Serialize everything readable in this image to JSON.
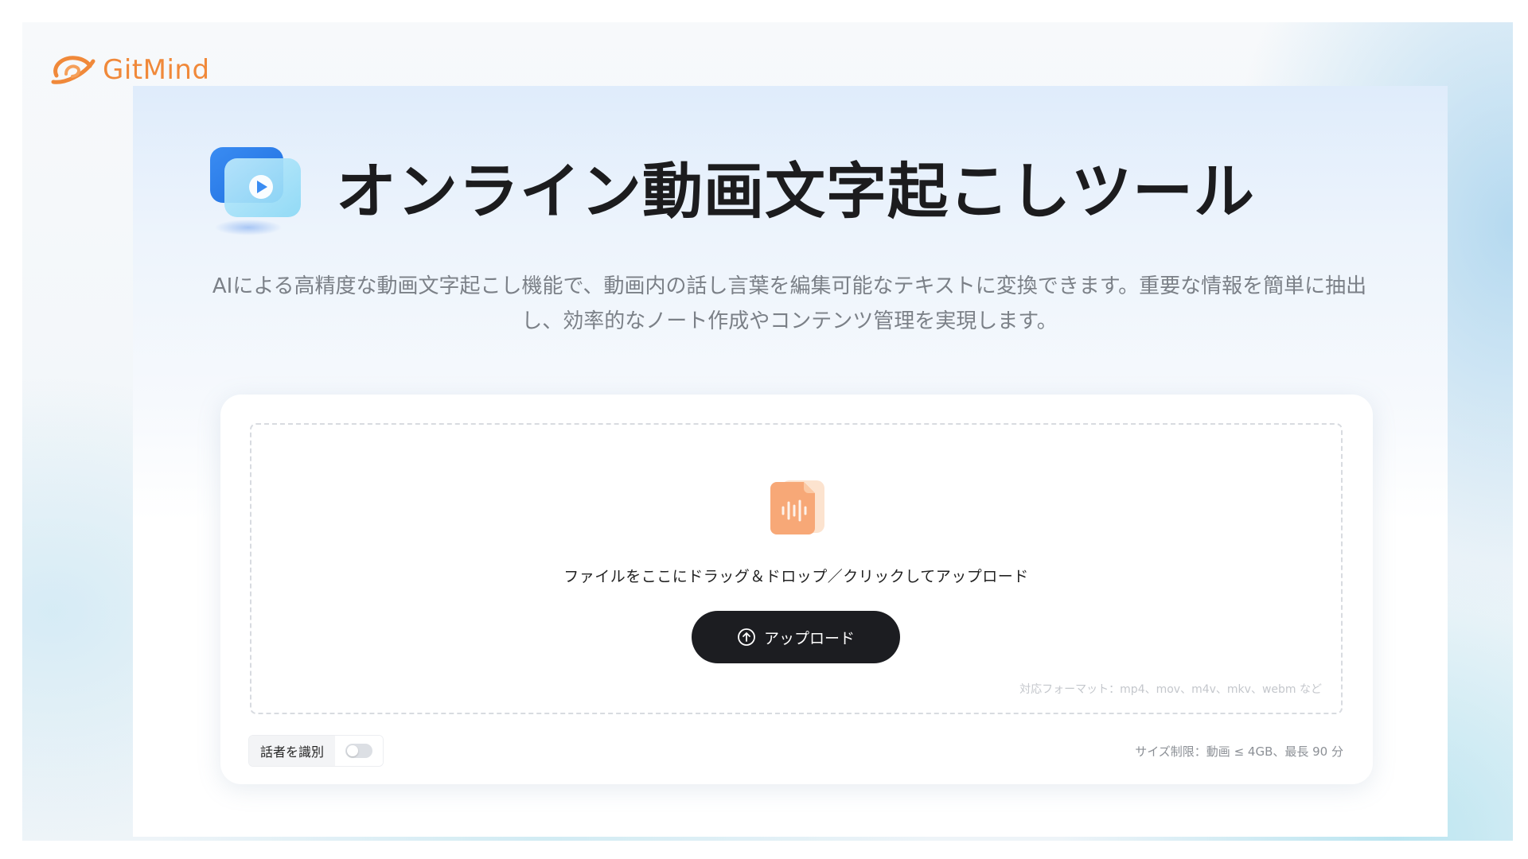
{
  "brand": {
    "name": "GitMind",
    "color": "#f0893a"
  },
  "hero": {
    "icon": "video-play-icon",
    "title": "オンライン動画文字起こしツール",
    "description": "AIによる高精度な動画文字起こし機能で、動画内の話し言葉を編集可能なテキストに変換できます。重要な情報を簡単に抽出し、効率的なノート作成やコンテンツ管理を実現します。"
  },
  "upload": {
    "file_icon": "audio-file-icon",
    "drop_text": "ファイルをここにドラッグ＆ドロップ／クリックしてアップロード",
    "button_label": "アップロード",
    "button_icon": "upload-circle-icon",
    "formats": "対応フォーマット：mp4、mov、m4v、mkv、webm など"
  },
  "options": {
    "speaker_label": "話者を識別",
    "speaker_enabled": false,
    "size_limit": "サイズ制限：動画 ≤ 4GB、最長 90 分"
  },
  "colors": {
    "button_bg": "#1c1d21",
    "title_text": "#1c1c1e",
    "desc_text": "#7b8087"
  }
}
